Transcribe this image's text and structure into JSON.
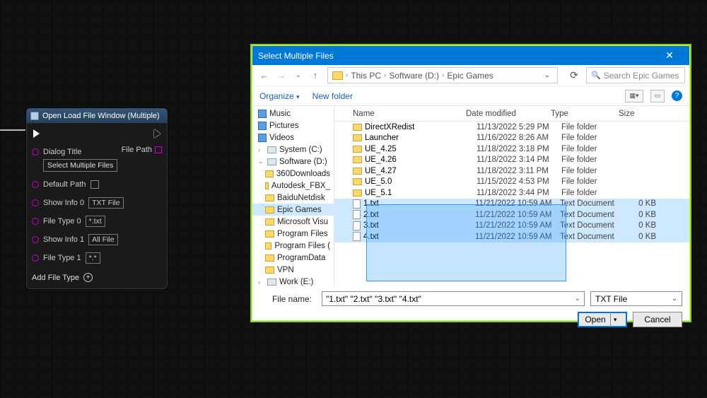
{
  "node": {
    "title": "Open Load File Window (Multiple)",
    "out_pin_label": "File Path",
    "dialog_title_label": "Dialog Title",
    "dialog_title_value": "Select Multiple Files",
    "default_path_label": "Default Path",
    "show_info0_label": "Show Info 0",
    "show_info0_value": "TXT File",
    "file_type0_label": "File Type 0",
    "file_type0_value": "*.txt",
    "show_info1_label": "Show Info 1",
    "show_info1_value": "All File",
    "file_type1_label": "File Type 1",
    "file_type1_value": "*.*",
    "add_file_type": "Add File Type"
  },
  "dialog": {
    "title": "Select Multiple Files",
    "breadcrumbs": {
      "pc": "This PC",
      "drive": "Software (D:)",
      "folder": "Epic Games"
    },
    "search_placeholder": "Search Epic Games",
    "organize": "Organize",
    "newfolder": "New folder",
    "columns": {
      "name": "Name",
      "date": "Date modified",
      "type": "Type",
      "size": "Size"
    },
    "tree": {
      "music": "Music",
      "pictures": "Pictures",
      "videos": "Videos",
      "sysc": "System (C:)",
      "softd": "Software (D:)",
      "d_items": [
        "360Downloads",
        "Autodesk_FBX_",
        "BaiduNetdisk",
        "Epic Games",
        "Microsoft Visu",
        "Program Files",
        "Program Files (",
        "ProgramData",
        "VPN"
      ],
      "work": "Work (E:)"
    },
    "rows": [
      {
        "name": "DirectXRedist",
        "date": "11/13/2022 5:29 PM",
        "type": "File folder",
        "size": "",
        "kind": "folder",
        "sel": false
      },
      {
        "name": "Launcher",
        "date": "11/16/2022 8:26 AM",
        "type": "File folder",
        "size": "",
        "kind": "folder",
        "sel": false
      },
      {
        "name": "UE_4.25",
        "date": "11/18/2022 3:18 PM",
        "type": "File folder",
        "size": "",
        "kind": "folder",
        "sel": false
      },
      {
        "name": "UE_4.26",
        "date": "11/18/2022 3:14 PM",
        "type": "File folder",
        "size": "",
        "kind": "folder",
        "sel": false
      },
      {
        "name": "UE_4.27",
        "date": "11/18/2022 3:11 PM",
        "type": "File folder",
        "size": "",
        "kind": "folder",
        "sel": false
      },
      {
        "name": "UE_5.0",
        "date": "11/15/2022 4:53 PM",
        "type": "File folder",
        "size": "",
        "kind": "folder",
        "sel": false
      },
      {
        "name": "UE_5.1",
        "date": "11/18/2022 3:44 PM",
        "type": "File folder",
        "size": "",
        "kind": "folder",
        "sel": false
      },
      {
        "name": "1.txt",
        "date": "11/21/2022 10:59 AM",
        "type": "Text Document",
        "size": "0 KB",
        "kind": "file",
        "sel": true
      },
      {
        "name": "2.txt",
        "date": "11/21/2022 10:59 AM",
        "type": "Text Document",
        "size": "0 KB",
        "kind": "file",
        "sel": true
      },
      {
        "name": "3.txt",
        "date": "11/21/2022 10:59 AM",
        "type": "Text Document",
        "size": "0 KB",
        "kind": "file",
        "sel": true
      },
      {
        "name": "4.txt",
        "date": "11/21/2022 10:59 AM",
        "type": "Text Document",
        "size": "0 KB",
        "kind": "file",
        "sel": true
      }
    ],
    "filename_label": "File name:",
    "filename_value": "\"1.txt\" \"2.txt\" \"3.txt\" \"4.txt\"",
    "filter_value": "TXT File",
    "open_btn": "Open",
    "cancel_btn": "Cancel"
  }
}
